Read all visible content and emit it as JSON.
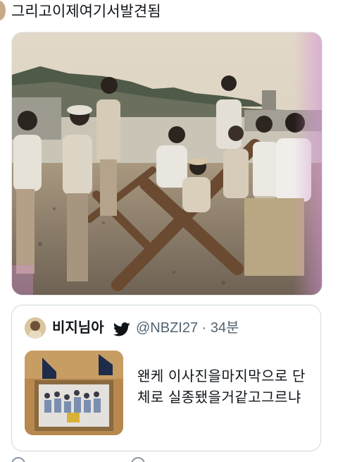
{
  "tweet": {
    "text": "그리고이제여기서발견됨"
  },
  "quoted_tweet": {
    "display_name": "비지님아",
    "handle_time": "@NBZI27 · 34분",
    "body": "왠케 이사진을마지막으로 단체로 실종됐을거같고그르냐"
  },
  "icons": {
    "verified_bird": "twitter-bird-icon"
  },
  "colors": {
    "text": "#0f1419",
    "secondary": "#536471",
    "border": "#cfd9de"
  }
}
